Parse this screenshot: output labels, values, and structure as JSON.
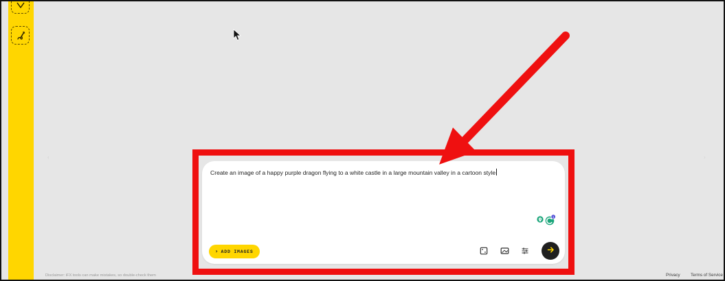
{
  "sidebar": {
    "tools": [
      {
        "icon": "shield-icon"
      },
      {
        "icon": "edit-icon"
      }
    ]
  },
  "prompt": {
    "text": "Create an image of a happy purple dragon flying to a white castle in a large mountain valley in a cartoon style"
  },
  "actions": {
    "add_images_label": "ADD IMAGES",
    "add_images_icon": "chevron-right-icon",
    "tools": [
      {
        "icon": "dice-icon"
      },
      {
        "icon": "aspect-ratio-icon"
      },
      {
        "icon": "sliders-icon"
      }
    ],
    "send_icon": "arrow-right-icon"
  },
  "footer": {
    "disclaimer": "Disclaimer: iFX tools can make mistakes, so double-check them",
    "privacy": "Privacy",
    "terms": "Terms of Service"
  },
  "annotation": {
    "color": "#ef1010"
  },
  "theme": {
    "accent": "#ffd600",
    "background": "#e6e6e6",
    "card": "#ffffff",
    "send_button": "#1f1f1f"
  }
}
